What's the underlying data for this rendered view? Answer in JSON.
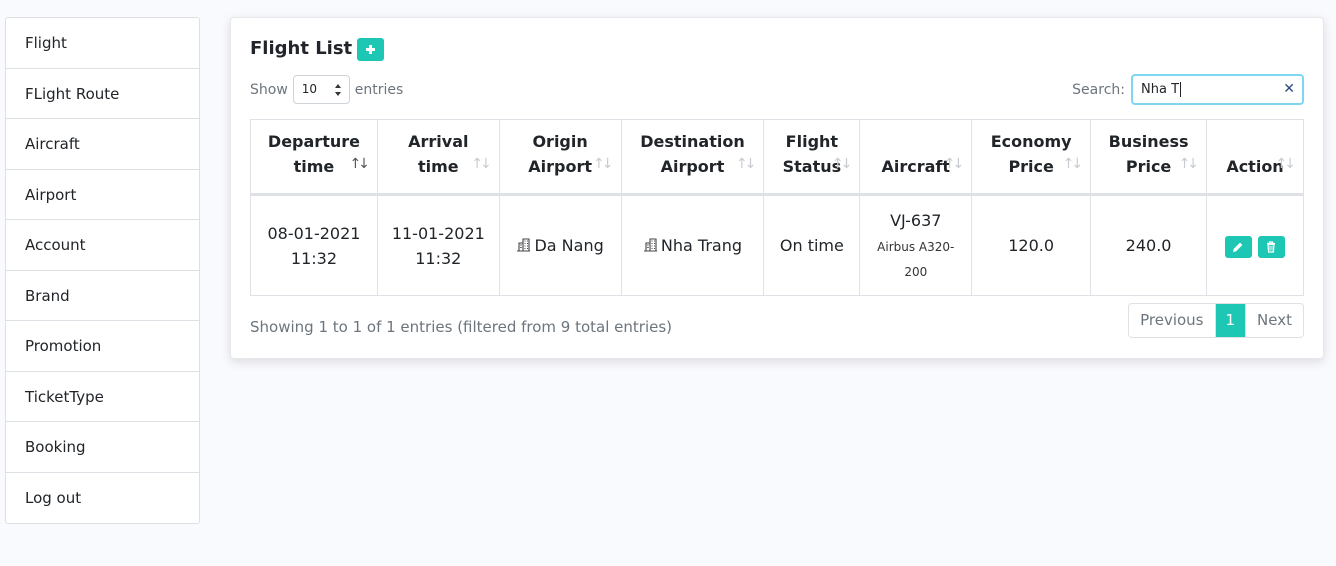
{
  "sidebar": {
    "items": [
      "Flight",
      "FLight Route",
      "Aircraft",
      "Airport",
      "Account",
      "Brand",
      "Promotion",
      "TicketType",
      "Booking",
      "Log out"
    ]
  },
  "card": {
    "title": "Flight List"
  },
  "length": {
    "show": "Show",
    "value": "10",
    "entries": "entries"
  },
  "search": {
    "label": "Search:",
    "value": "Nha T"
  },
  "table": {
    "headers": [
      [
        "Departure",
        "time"
      ],
      [
        "Arrival",
        "time"
      ],
      [
        "Origin",
        "Airport"
      ],
      [
        "Destination",
        "Airport"
      ],
      [
        "Flight",
        "Status"
      ],
      [
        "Aircraft"
      ],
      [
        "Economy",
        "Price"
      ],
      [
        "Business",
        "Price"
      ],
      [
        "Action"
      ]
    ],
    "rows": [
      {
        "departure_date": "08-01-2021",
        "departure_time": "11:32",
        "arrival_date": "11-01-2021",
        "arrival_time": "11:32",
        "origin": "Da Nang",
        "destination": "Nha Trang",
        "status": "On time",
        "aircraft_code": "VJ-637",
        "aircraft_model_1": "Airbus A320-",
        "aircraft_model_2": "200",
        "economy_price": "120.0",
        "business_price": "240.0"
      }
    ]
  },
  "footer": {
    "info": "Showing 1 to 1 of 1 entries (filtered from 9 total entries)",
    "previous": "Previous",
    "page": "1",
    "next": "Next"
  },
  "colors": {
    "accent": "#1ec7b4",
    "background": "#f9fafd"
  },
  "icons": {
    "add": "plus-icon",
    "airport": "building-icon",
    "edit": "pencil-icon",
    "delete": "trash-icon",
    "clear": "close-icon"
  }
}
